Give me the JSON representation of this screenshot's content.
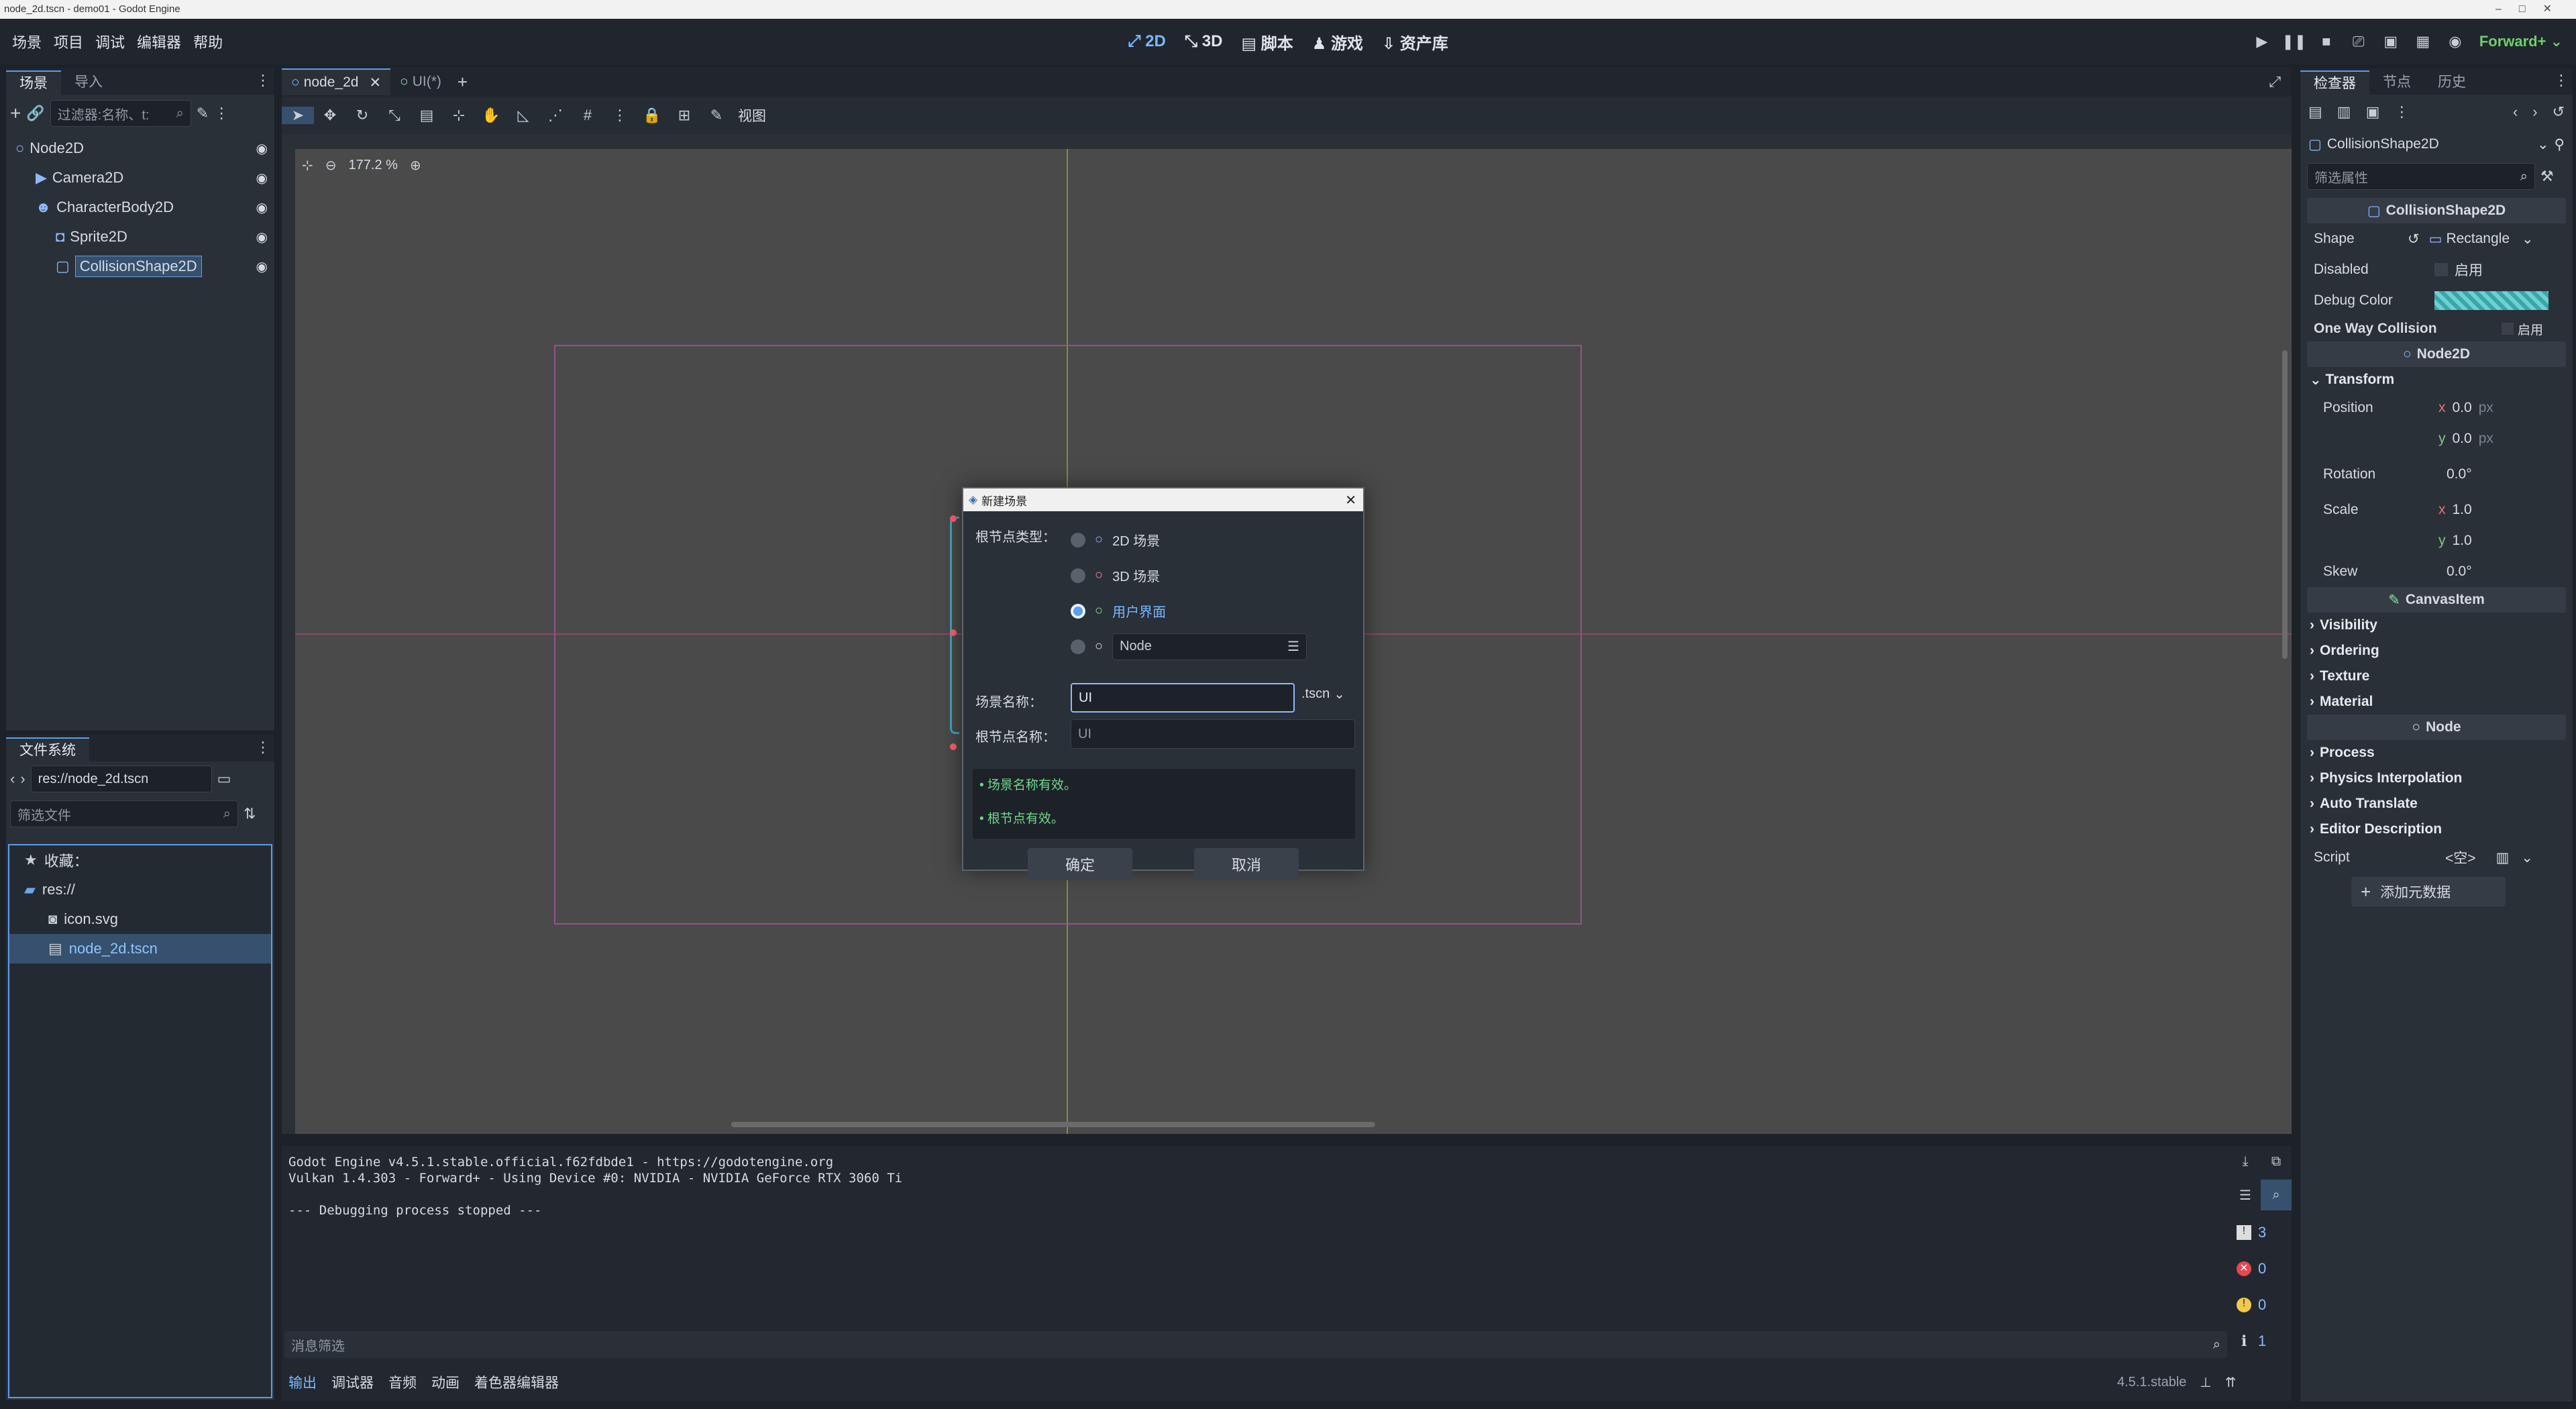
{
  "window_title": "node_2d.tscn - demo01 - Godot Engine",
  "menu": [
    "场景",
    "项目",
    "调试",
    "编辑器",
    "帮助"
  ],
  "workspaces": [
    {
      "label": "2D",
      "active": true
    },
    {
      "label": "3D",
      "active": false
    },
    {
      "label": "脚本",
      "active": false
    },
    {
      "label": "游戏",
      "active": false
    },
    {
      "label": "资产库",
      "active": false
    }
  ],
  "renderer": "Forward+",
  "scene_dock": {
    "tabs": [
      "场景",
      "导入"
    ],
    "filter_placeholder": "过滤器:名称、t:",
    "nodes": [
      {
        "name": "Node2D",
        "icon": "node2d-icon",
        "depth": 0,
        "selected": false
      },
      {
        "name": "Camera2D",
        "icon": "camera-icon",
        "depth": 1,
        "selected": false
      },
      {
        "name": "CharacterBody2D",
        "icon": "character-icon",
        "depth": 1,
        "selected": false
      },
      {
        "name": "Sprite2D",
        "icon": "sprite-icon",
        "depth": 2,
        "selected": false
      },
      {
        "name": "CollisionShape2D",
        "icon": "collision-icon",
        "depth": 2,
        "selected": true
      }
    ]
  },
  "filesystem": {
    "title": "文件系统",
    "path": "res://node_2d.tscn",
    "filter_placeholder": "筛选文件",
    "items": [
      {
        "name": "收藏：",
        "icon": "star-icon",
        "depth": 0,
        "selected": false
      },
      {
        "name": "res://",
        "icon": "folder-icon",
        "depth": 0,
        "selected": false
      },
      {
        "name": "icon.svg",
        "icon": "image-icon",
        "depth": 1,
        "selected": false
      },
      {
        "name": "node_2d.tscn",
        "icon": "scene-icon",
        "depth": 1,
        "selected": true
      }
    ]
  },
  "editor_tabs": [
    {
      "label": "node_2d",
      "active": true
    },
    {
      "label": "UI(*)",
      "active": false
    }
  ],
  "toolbar": {
    "view_label": "视图"
  },
  "zoom": "177.2 %",
  "dialog": {
    "title": "新建场景",
    "root_type_label": "根节点类型：",
    "options": [
      {
        "label": "2D 场景",
        "selected": false,
        "color": "#8fb8ff"
      },
      {
        "label": "3D 场景",
        "selected": false,
        "color": "#ff8c8c"
      },
      {
        "label": "用户界面",
        "selected": true,
        "color": "#8ce0a4"
      },
      {
        "label": "Node",
        "selected": false,
        "color": "#e0e0e0"
      }
    ],
    "scene_name_label": "场景名称：",
    "scene_name_value": "UI",
    "extension": ".tscn",
    "root_name_label": "根节点名称：",
    "root_name_placeholder": "UI",
    "messages": [
      "• 场景名称有效。",
      "• 根节点有效。"
    ],
    "ok": "确定",
    "cancel": "取消"
  },
  "output": {
    "lines": [
      "Godot Engine v4.5.1.stable.official.f62fdbde1 - https://godotengine.org",
      "Vulkan 1.4.303 - Forward+ - Using Device #0: NVIDIA - NVIDIA GeForce RTX 3060 Ti",
      "",
      "--- Debugging process stopped ---"
    ],
    "filter_placeholder": "消息筛选",
    "counts": {
      "messages": "3",
      "errors": "0",
      "warnings": "0",
      "info": "1"
    }
  },
  "bottom_tabs": [
    "输出",
    "调试器",
    "音频",
    "动画",
    "着色器编辑器"
  ],
  "version": "4.5.1.stable",
  "inspector": {
    "tabs": [
      "检查器",
      "节点",
      "历史"
    ],
    "object": "CollisionShape2D",
    "filter_placeholder": "筛选属性",
    "class_header": "CollisionShape2D",
    "props": {
      "shape_label": "Shape",
      "shape_value": "Rectangle",
      "disabled_label": "Disabled",
      "enable_label": "启用",
      "debug_color_label": "Debug Color",
      "one_way_label": "One Way Collision"
    },
    "node2d_header": "Node2D",
    "transform": "Transform",
    "position_label": "Position",
    "pos_x": "0.0",
    "pos_y": "0.0",
    "px": "px",
    "rotation_label": "Rotation",
    "rotation": "0.0",
    "scale_label": "Scale",
    "scale_x": "1.0",
    "scale_y": "1.0",
    "skew_label": "Skew",
    "skew": "0.0",
    "canvasitem_header": "CanvasItem",
    "canvasitem_sections": [
      "Visibility",
      "Ordering",
      "Texture",
      "Material"
    ],
    "node_header": "Node",
    "node_sections": [
      "Process",
      "Physics Interpolation",
      "Auto Translate",
      "Editor Description"
    ],
    "script_label": "Script",
    "script_value": "<空>",
    "add_metadata": "添加元数据"
  }
}
